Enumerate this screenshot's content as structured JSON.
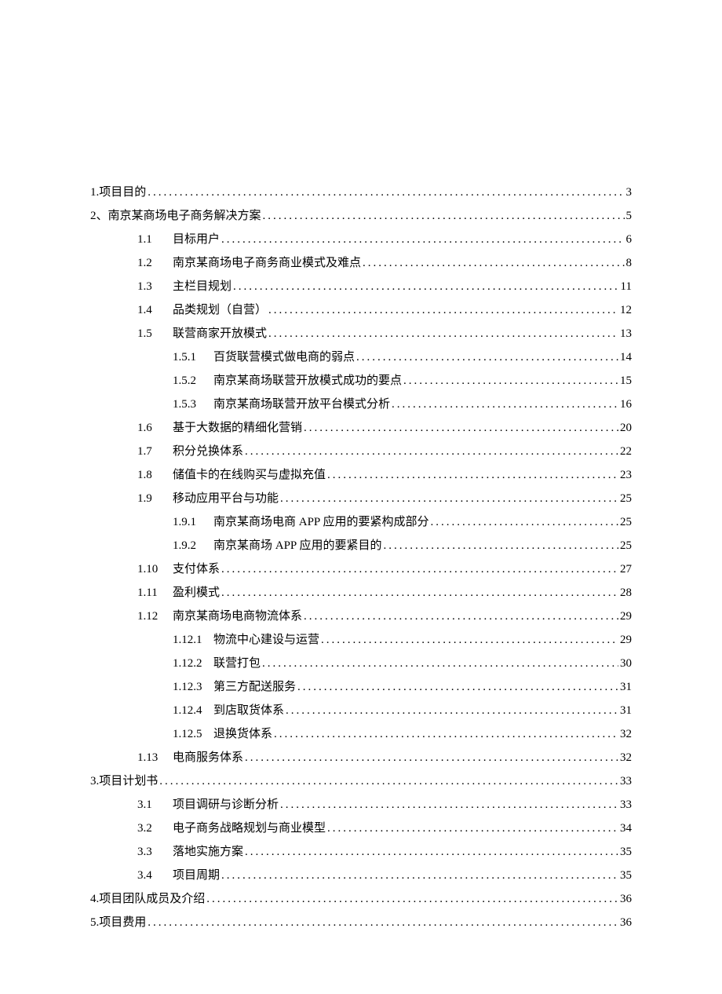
{
  "toc": [
    {
      "indent": 0,
      "num": "1.",
      "title": "项目目的",
      "page": "3",
      "gap": ""
    },
    {
      "indent": 0,
      "num": "2、",
      "title": "南京某商场电子商务解决方案 ",
      "page": "5",
      "gap": ""
    },
    {
      "indent": 1,
      "num": "1.1",
      "title": "目标用户",
      "page": "6",
      "gap": ""
    },
    {
      "indent": 1,
      "num": "1.2",
      "title": "南京某商场电子商务商业模式及难点",
      "page": "8",
      "gap": ""
    },
    {
      "indent": 1,
      "num": "1.3",
      "title": "主栏目规划",
      "page": "11",
      "gap": ""
    },
    {
      "indent": 1,
      "num": "1.4",
      "title": "品类规划（自营）",
      "page": "12",
      "gap": ""
    },
    {
      "indent": 1,
      "num": "1.5",
      "title": "联营商家开放模式",
      "page": "13",
      "gap": ""
    },
    {
      "indent": 2,
      "num": "1.5.1",
      "title": "百货联营模式做电商的弱点",
      "page": "14",
      "gap": ""
    },
    {
      "indent": 2,
      "num": "1.5.2",
      "title": "南京某商场联营开放模式成功的要点",
      "page": "15",
      "gap": ""
    },
    {
      "indent": 2,
      "num": "1.5.3",
      "title": "南京某商场联营开放平台模式分析",
      "page": "16",
      "gap": ""
    },
    {
      "indent": 1,
      "num": "1.6",
      "title": "基于大数据的精细化营销",
      "page": "20",
      "gap": ""
    },
    {
      "indent": 1,
      "num": "1.7",
      "title": "积分兑换体系",
      "page": "22",
      "gap": ""
    },
    {
      "indent": 1,
      "num": "1.8",
      "title": "储值卡的在线购买与虚拟充值",
      "page": "23",
      "gap": ""
    },
    {
      "indent": 1,
      "num": "1.9",
      "title": "移动应用平台与功能",
      "page": "25",
      "gap": ""
    },
    {
      "indent": 2,
      "num": "1.9.1",
      "title": "南京某商场电商 APP 应用的要紧构成部分",
      "page": "25",
      "gap": ""
    },
    {
      "indent": 2,
      "num": "1.9.2",
      "title": "南京某商场 APP 应用的要紧目的",
      "page": "25",
      "gap": ""
    },
    {
      "indent": 1,
      "num": "1.10",
      "title": "支付体系 ",
      "page": "27",
      "gap": " "
    },
    {
      "indent": 1,
      "num": "1.11",
      "title": "盈利模式 ",
      "page": "28",
      "gap": " "
    },
    {
      "indent": 1,
      "num": "1.12",
      "title": "南京某商场电商物流体系 ",
      "page": "29",
      "gap": " "
    },
    {
      "indent": 2,
      "num": "1.12.1",
      "title": "物流中心建设与运营",
      "page": "29",
      "gap": " "
    },
    {
      "indent": 2,
      "num": "1.12.2",
      "title": "联营打包",
      "page": "30",
      "gap": " "
    },
    {
      "indent": 2,
      "num": "1.12.3",
      "title": "第三方配送服务",
      "page": "31",
      "gap": " "
    },
    {
      "indent": 2,
      "num": "1.12.4",
      "title": "到店取货体系",
      "page": "31",
      "gap": " "
    },
    {
      "indent": 2,
      "num": "1.12.5",
      "title": "退换货体系",
      "page": "32",
      "gap": " "
    },
    {
      "indent": 1,
      "num": "1.13",
      "title": "电商服务体系",
      "page": "32",
      "gap": " "
    },
    {
      "indent": 0,
      "num": "3",
      "title": ".项目计划书",
      "page": "33",
      "gap": "   "
    },
    {
      "indent": 1,
      "num": "3.1",
      "title": "项目调研与诊断分析",
      "page": "33",
      "gap": ""
    },
    {
      "indent": 1,
      "num": "3.2",
      "title": "电子商务战略规划与商业模型",
      "page": "34",
      "gap": ""
    },
    {
      "indent": 1,
      "num": "3.3",
      "title": "落地实施方案",
      "page": "35",
      "gap": ""
    },
    {
      "indent": 1,
      "num": "3.4",
      "title": "项目周期",
      "page": "35",
      "gap": ""
    },
    {
      "indent": 0,
      "num": "4",
      "title": ".项目团队成员及介绍",
      "page": "36",
      "gap": "   "
    },
    {
      "indent": 0,
      "num": "5",
      "title": ".项目费用",
      "page": "36",
      "gap": "   "
    }
  ]
}
